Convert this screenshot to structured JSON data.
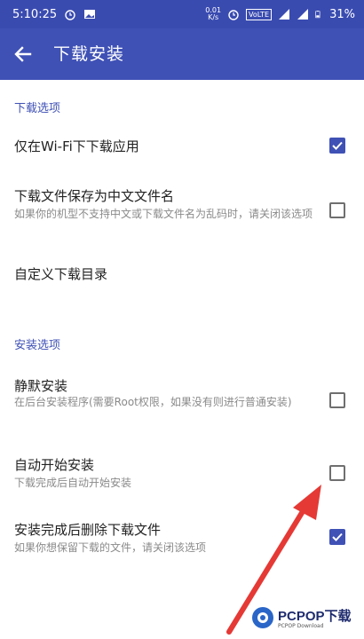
{
  "status_bar": {
    "time": "5:10:25",
    "net_speed_value": "0.01",
    "net_speed_unit": "K/s",
    "volte": "VoLTE",
    "battery": "31%",
    "icons": [
      "alarm-icon",
      "image-icon",
      "alarm-icon",
      "signal-icon",
      "signal-icon",
      "battery-icon"
    ]
  },
  "header": {
    "title": "下载安装",
    "back_icon": "arrow-back-icon"
  },
  "sections": {
    "download": {
      "header": "下载选项",
      "items": [
        {
          "title": "仅在Wi-Fi下下载应用",
          "subtitle": "",
          "checked": true
        },
        {
          "title": "下载文件保存为中文文件名",
          "subtitle": "如果你的机型不支持中文或下载文件名为乱码时，请关闭该选项",
          "checked": false
        },
        {
          "title": "自定义下载目录",
          "subtitle": ""
        }
      ]
    },
    "install": {
      "header": "安装选项",
      "items": [
        {
          "title": "静默安装",
          "subtitle": "在后台安装程序(需要Root权限，如果没有则进行普通安装)",
          "checked": false
        },
        {
          "title": "自动开始安装",
          "subtitle": "下载完成后自动开始安装",
          "checked": false
        },
        {
          "title": "安装完成后删除下载文件",
          "subtitle": "如果你想保留下载的文件，请关闭该选项",
          "checked": true
        }
      ]
    }
  },
  "watermark": {
    "brand": "PCPOP下载",
    "sub": "PCPOP Download"
  },
  "colors": {
    "primary": "#3f51b5",
    "status_bar": "#3a4bb0",
    "annotation_arrow": "#e53935"
  }
}
